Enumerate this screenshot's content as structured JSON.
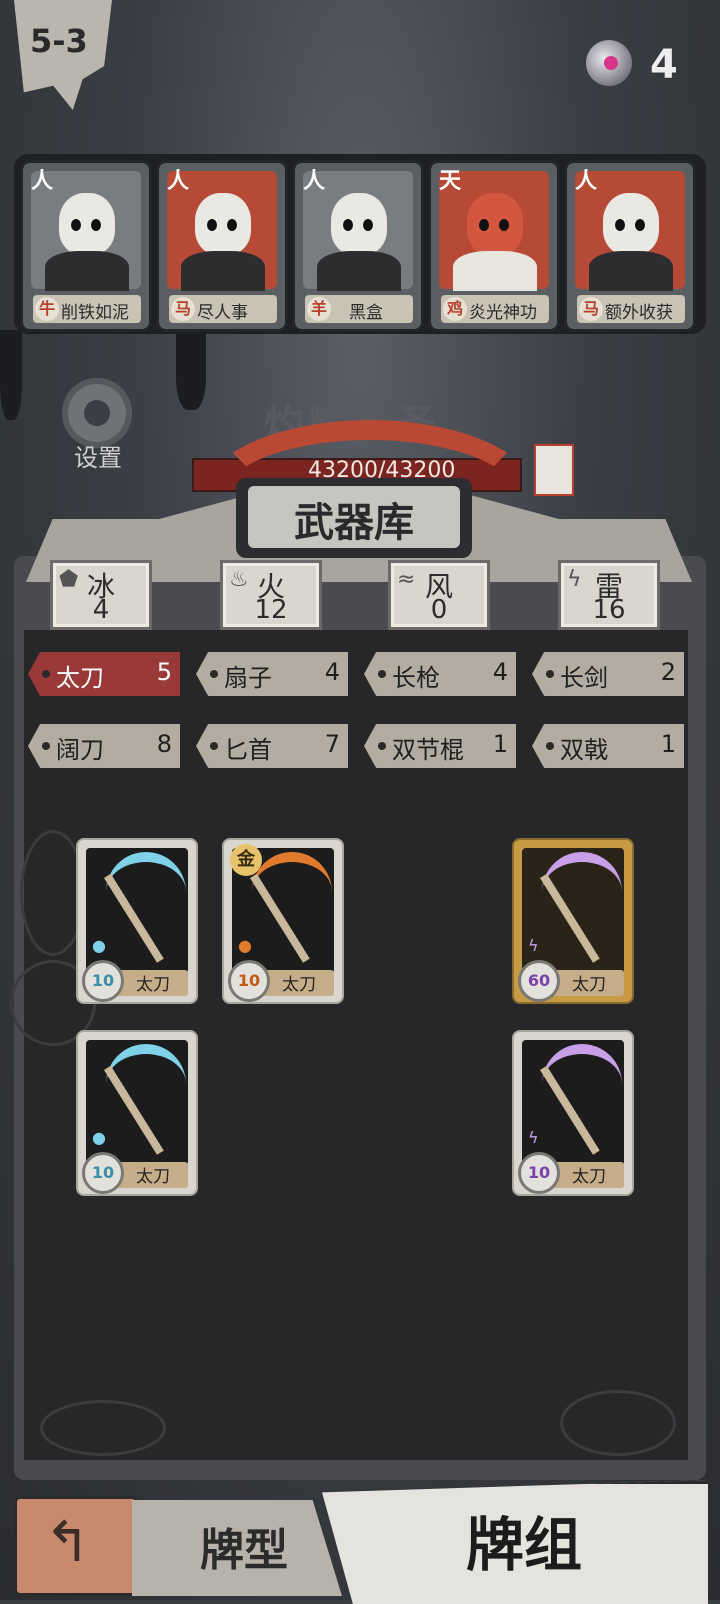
{
  "level": "5-3",
  "currency": {
    "count": "4",
    "icon": "gem-icon"
  },
  "team": [
    {
      "tier": "人",
      "zodiac": "牛",
      "skill": "削铁如泥"
    },
    {
      "tier": "人",
      "zodiac": "马",
      "skill": "尽人事"
    },
    {
      "tier": "人",
      "zodiac": "羊",
      "skill": "黑盒"
    },
    {
      "tier": "天",
      "zodiac": "鸡",
      "skill": "炎光神功"
    },
    {
      "tier": "人",
      "zodiac": "马",
      "skill": "额外收获"
    }
  ],
  "settings_label": "设置",
  "boss": {
    "name": "灼辉大圣",
    "hp": "43200/43200"
  },
  "armory": {
    "title": "武器库",
    "elements": [
      {
        "name": "冰",
        "value": "4"
      },
      {
        "name": "火",
        "value": "12"
      },
      {
        "name": "风",
        "value": "0"
      },
      {
        "name": "雷",
        "value": "16"
      }
    ],
    "weapon_types": [
      {
        "name": "太刀",
        "count": "5",
        "active": true
      },
      {
        "name": "扇子",
        "count": "4"
      },
      {
        "name": "长枪",
        "count": "4"
      },
      {
        "name": "长剑",
        "count": "2"
      },
      {
        "name": "阔刀",
        "count": "8"
      },
      {
        "name": "匕首",
        "count": "7"
      },
      {
        "name": "双节棍",
        "count": "1"
      },
      {
        "name": "双戟",
        "count": "1"
      }
    ],
    "cards": [
      {
        "name": "太刀",
        "level": "10",
        "element": "ice"
      },
      {
        "name": "太刀",
        "level": "10",
        "element": "fire",
        "badge": "金"
      },
      {
        "name": "太刀",
        "level": "60",
        "element": "thunder",
        "rarity": "gold"
      },
      {
        "name": "太刀",
        "level": "10",
        "element": "ice"
      },
      {
        "name": "太刀",
        "level": "10",
        "element": "thunder"
      }
    ]
  },
  "nav": {
    "back_icon": "back-arrow-icon",
    "tab_type": "牌型",
    "tab_deck": "牌组"
  }
}
